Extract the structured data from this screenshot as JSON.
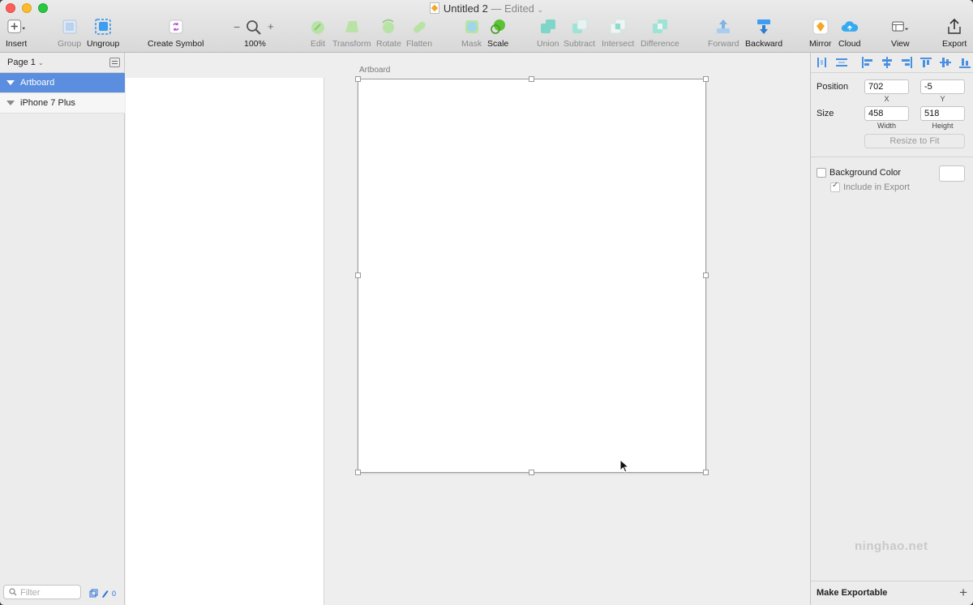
{
  "window": {
    "title": "Untitled 2",
    "status": "— Edited",
    "status_chevron": "⌄"
  },
  "toolbar": {
    "insert": "Insert",
    "group": "Group",
    "ungroup": "Ungroup",
    "create_symbol": "Create Symbol",
    "zoom_minus": "−",
    "zoom_plus": "+",
    "zoom_level": "100%",
    "edit": "Edit",
    "transform": "Transform",
    "rotate": "Rotate",
    "flatten": "Flatten",
    "mask": "Mask",
    "scale": "Scale",
    "union": "Union",
    "subtract": "Subtract",
    "intersect": "Intersect",
    "difference": "Difference",
    "forward": "Forward",
    "backward": "Backward",
    "mirror": "Mirror",
    "cloud": "Cloud",
    "view": "View",
    "export": "Export"
  },
  "sidebar": {
    "page": "Page 1",
    "layers": [
      {
        "label": "Artboard",
        "selected": true
      },
      {
        "label": "iPhone 7 Plus",
        "selected": false
      }
    ],
    "filter_placeholder": "Filter",
    "edit_count": "0"
  },
  "canvas": {
    "artboard_title": "Artboard"
  },
  "inspector": {
    "position_label": "Position",
    "x_value": "702",
    "y_value": "-5",
    "x_label": "X",
    "y_label": "Y",
    "size_label": "Size",
    "width_value": "458",
    "height_value": "518",
    "width_label": "Width",
    "height_label": "Height",
    "resize_button": "Resize to Fit",
    "background_color_label": "Background Color",
    "include_in_export_label": "Include in Export",
    "watermark": "ninghao.net",
    "make_exportable": "Make Exportable",
    "add_symbol": "+"
  },
  "colors": {
    "selection": "#5b8ede",
    "accent": "#4a90e2",
    "sketch_orange": "#f5a623",
    "operation_teal": "#7fd6c8"
  }
}
